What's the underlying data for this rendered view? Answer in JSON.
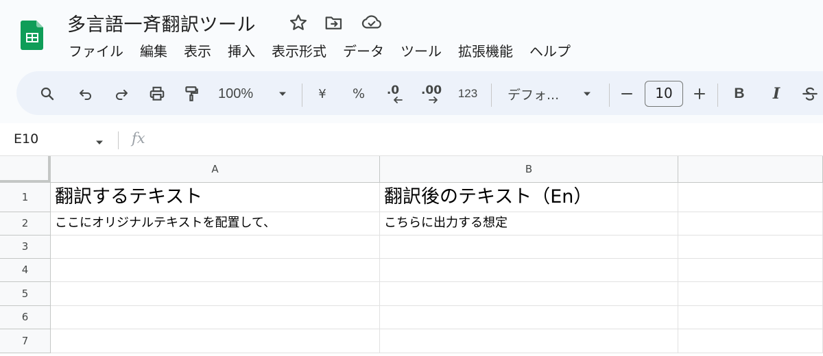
{
  "app": {
    "doc_title": "多言語一斉翻訳ツール",
    "brand_color": "#0f9d58"
  },
  "title_icons": [
    "star-icon",
    "move-to-folder-icon",
    "cloud-saved-icon"
  ],
  "menu": {
    "items": [
      "ファイル",
      "編集",
      "表示",
      "挿入",
      "表示形式",
      "データ",
      "ツール",
      "拡張機能",
      "ヘルプ"
    ]
  },
  "toolbar": {
    "zoom": "100%",
    "currency_label": "¥",
    "percent_label": "%",
    "decrease_decimal_label": ".0",
    "increase_decimal_label": ".00",
    "number_format_label": "123",
    "font_name": "デフォ...",
    "font_size": "10",
    "bold_label": "B",
    "italic_label": "I"
  },
  "formula_bar": {
    "cell_ref": "E10",
    "fx_label": "fx",
    "value": ""
  },
  "sheet": {
    "columns": [
      "A",
      "B",
      ""
    ],
    "rows": [
      {
        "num": "1",
        "cells": [
          "翻訳するテキスト",
          "翻訳後のテキスト（En）",
          ""
        ]
      },
      {
        "num": "2",
        "cells": [
          "ここにオリジナルテキストを配置して、",
          "こちらに出力する想定",
          ""
        ]
      },
      {
        "num": "3",
        "cells": [
          "",
          "",
          ""
        ]
      },
      {
        "num": "4",
        "cells": [
          "",
          "",
          ""
        ]
      },
      {
        "num": "5",
        "cells": [
          "",
          "",
          ""
        ]
      },
      {
        "num": "6",
        "cells": [
          "",
          "",
          ""
        ]
      },
      {
        "num": "7",
        "cells": [
          "",
          "",
          ""
        ]
      }
    ]
  }
}
